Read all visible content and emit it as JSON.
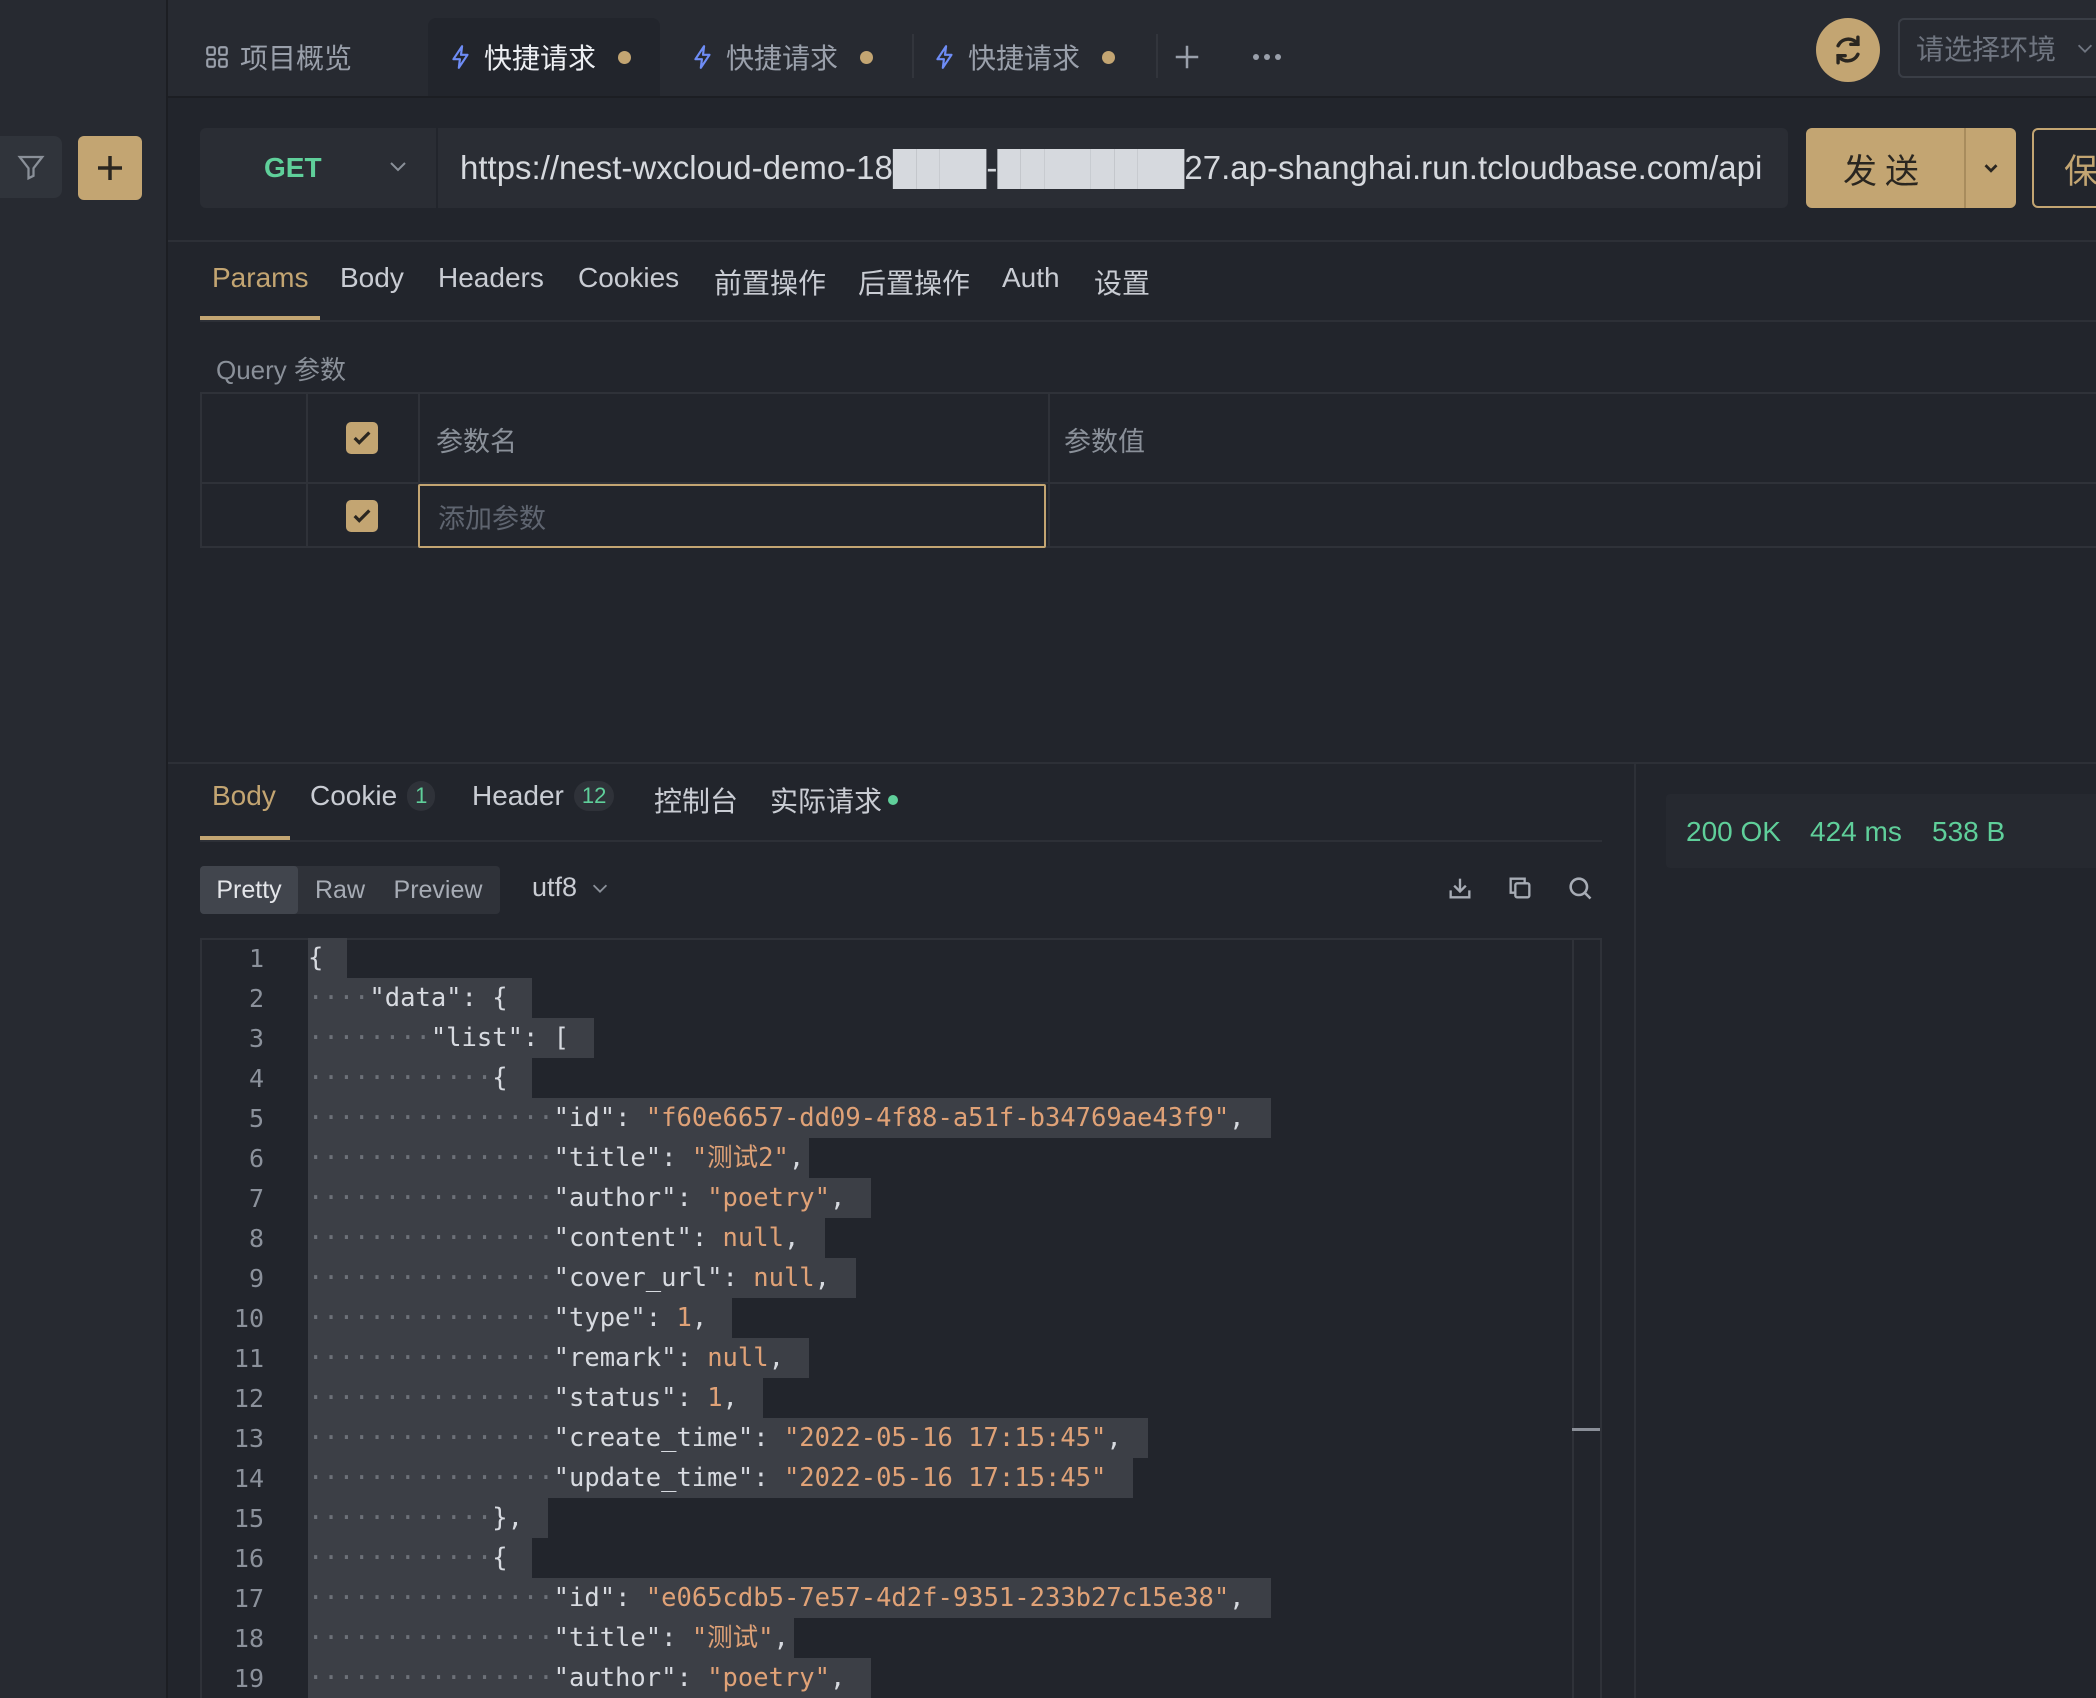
{
  "tabs": {
    "overview": "项目概览",
    "items": [
      "快捷请求",
      "快捷请求",
      "快捷请求"
    ],
    "add": "+",
    "more": "···"
  },
  "env_placeholder": "请选择环境",
  "request": {
    "method": "GET",
    "url": "https://nest-wxcloud-demo-18████-████████27.ap-shanghai.run.tcloudbase.com/api",
    "send_label": "发送",
    "save_label": "保"
  },
  "request_tabs": [
    "Params",
    "Body",
    "Headers",
    "Cookies",
    "前置操作",
    "后置操作",
    "Auth",
    "设置"
  ],
  "query": {
    "section_label": "Query 参数",
    "col_name": "参数名",
    "col_value": "参数值",
    "add_placeholder": "添加参数"
  },
  "response_tabs": {
    "body": "Body",
    "cookie": "Cookie",
    "cookie_count": "1",
    "header": "Header",
    "header_count": "12",
    "console": "控制台",
    "actual": "实际请求"
  },
  "view_modes": [
    "Pretty",
    "Raw",
    "Preview"
  ],
  "encoding": "utf8",
  "status": {
    "code": "200 OK",
    "time": "424 ms",
    "size": "538 B"
  },
  "code_lines": [
    {
      "n": "1",
      "indent": 0,
      "text": "{"
    },
    {
      "n": "2",
      "indent": 1,
      "text": "\"data\": {"
    },
    {
      "n": "3",
      "indent": 2,
      "text": "\"list\": ["
    },
    {
      "n": "4",
      "indent": 3,
      "text": "{"
    },
    {
      "n": "5",
      "indent": 4,
      "text": "\"id\": \"f60e6657-dd09-4f88-a51f-b34769ae43f9\","
    },
    {
      "n": "6",
      "indent": 4,
      "text": "\"title\": \"测试2\","
    },
    {
      "n": "7",
      "indent": 4,
      "text": "\"author\": \"poetry\","
    },
    {
      "n": "8",
      "indent": 4,
      "text": "\"content\": null,"
    },
    {
      "n": "9",
      "indent": 4,
      "text": "\"cover_url\": null,"
    },
    {
      "n": "10",
      "indent": 4,
      "text": "\"type\": 1,"
    },
    {
      "n": "11",
      "indent": 4,
      "text": "\"remark\": null,"
    },
    {
      "n": "12",
      "indent": 4,
      "text": "\"status\": 1,"
    },
    {
      "n": "13",
      "indent": 4,
      "text": "\"create_time\": \"2022-05-16 17:15:45\","
    },
    {
      "n": "14",
      "indent": 4,
      "text": "\"update_time\": \"2022-05-16 17:15:45\""
    },
    {
      "n": "15",
      "indent": 3,
      "text": "},"
    },
    {
      "n": "16",
      "indent": 3,
      "text": "{"
    },
    {
      "n": "17",
      "indent": 4,
      "text": "\"id\": \"e065cdb5-7e57-4d2f-9351-233b27c15e38\","
    },
    {
      "n": "18",
      "indent": 4,
      "text": "\"title\": \"测试\","
    },
    {
      "n": "19",
      "indent": 4,
      "text": "\"author\": \"poetry\","
    }
  ],
  "colors": {
    "accent": "#c3a572",
    "success": "#5fcf9a",
    "tab_icon": "#6e8cf5",
    "string": "#e0a277",
    "background": "#22252c"
  }
}
